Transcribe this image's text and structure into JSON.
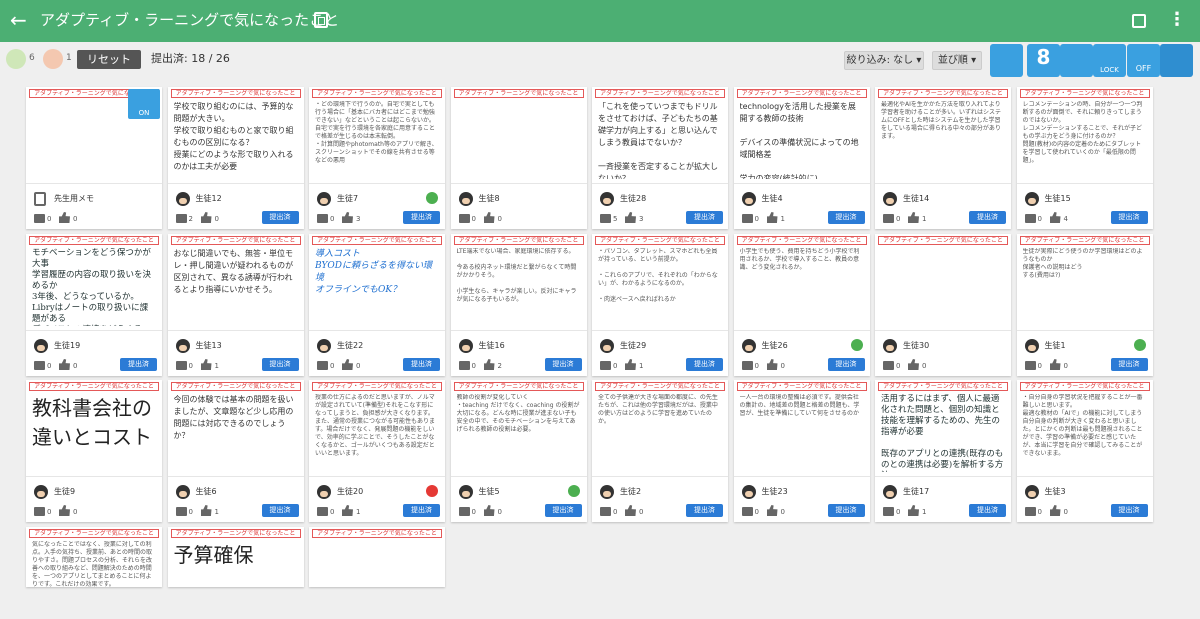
{
  "header": {
    "title": "アダプティブ・ラーニングで気になったこと",
    "back_icon": "arrow-left-icon",
    "copy_icon": "copy-icon",
    "translate_icon": "translate-icon",
    "more_icon": "more-vert-icon",
    "color": "#4caf73"
  },
  "toolbar": {
    "ok_label": "OK",
    "ok_count": "6",
    "ng_count": "1",
    "reset_label": "リセット",
    "submitted_text": "提出済: 18 / 26",
    "filter_label": "絞り込み: なし ▾",
    "sort_label": "並び順 ▾",
    "tools": {
      "font_size": "8",
      "lock_label": "LOCK",
      "off_label": "OFF"
    }
  },
  "card_tag": "アダプティブ・ラーニングで気になったこと",
  "submit_label": "提出済",
  "on_label": "ON",
  "cards": [
    {
      "name": "先生用メモ",
      "body": "",
      "comments": "0",
      "likes": "0"
    },
    {
      "name": "生徒12",
      "body": "学校で取り組むのには、予算的な問題が大きい。\n学校で取り組むものと家で取り組むものの区別になる？\n授業にどのような形で取り入れるのかは工夫が必要",
      "comments": "2",
      "likes": "0"
    },
    {
      "name": "生徒7",
      "body": "・どの環境下で行うのか。自宅で実としても行う場合に「基本にバカ者にはどこまで勉強できない」などということは起こらないか。\n自宅で実を行う環境を各家庭に用意することで格差が生じるのは本末転倒。\n・計算問題やphotomath等のアプリで解き、スクリーンショットでその線を共有させる等などの悪用",
      "comments": "0",
      "likes": "3"
    },
    {
      "name": "生徒8",
      "body": "",
      "comments": "0",
      "likes": "0"
    },
    {
      "name": "生徒28",
      "body": "「これを使っていつまでもドリルをさせておけば、子どもたちの基礎学力が向上する」と思い込んでしまう教員はでないか？\n\n一斉授業を否定することが拡大しないか？",
      "comments": "5",
      "likes": "3"
    },
    {
      "name": "生徒4",
      "body": "technologyを活用した授業を展開する教師の技術\n\nデバイスの準備状況によっての地域間格差\n\n学力の変容(統計的に)",
      "comments": "0",
      "likes": "1"
    },
    {
      "name": "生徒14",
      "body": "最適化やAIを生かかた方法を取り入れてより学習者を助けることが多い。いずれはシステムにOFFとした時はシステムを生かした学習をしている場合に得られる中々の部分があります。",
      "comments": "0",
      "likes": "1"
    },
    {
      "name": "生徒15",
      "body": "レコメンデーションの時、自分が一つ一つ判断するのが面倒で、それに頼りきってしまうのではないか。\nレコメンデーションすることで、それが子どもの学ぶ力をどう身に付けるのか？\n問題(教材)の内容の定着のためにタブレットを学習して使われていくのか「最低限の問題」。",
      "comments": "0",
      "likes": "4"
    },
    {
      "name": "生徒19",
      "body": "モチベーションをどう保つかが大事\n学習履歴の内容の取り扱いを決めるか\n3年後、どうなっているか。\nLibryはノートの取り扱いに課題がある\nデバイスとの連携をどうするか、費用負担をどうするか",
      "comments": "0",
      "likes": "0"
    },
    {
      "name": "生徒13",
      "body": "おなじ間違いでも、無答・単位モレ・押し間違いが疑われるものが区別されて、異なる誘導が行われるとより指導にいかせそう。",
      "comments": "0",
      "likes": "1"
    },
    {
      "name": "生徒22",
      "body": "導入コスト\nBYODに頼らざるを得ない環境\nオフラインでもOK？",
      "comments": "0",
      "likes": "0"
    },
    {
      "name": "生徒16",
      "body": "LTE端末でない場合、家庭環境に依存する。\n\n今ある校内ネット環境だと繋がらなくて時間がかかりそう。\n\n小学生なら、キャラが楽しい。反対にキャラが気になる子もいるが。",
      "comments": "0",
      "likes": "2"
    },
    {
      "name": "生徒29",
      "body": "・パソコン、タブレット、スマホどれも全員が持っている、という前提か。\n\n・これらのアプリで、それぞれの「わからない」が、わかるようになるのか。\n\n・肉迷ペースへ戻ればれるか",
      "comments": "0",
      "likes": "1"
    },
    {
      "name": "生徒26",
      "body": "小学生でも使う、費用を持ちどう小学校で利用されるか、学校で導入すること、教員の意識、どう変化されるか。",
      "comments": "0",
      "likes": "0"
    },
    {
      "name": "生徒30",
      "body": "",
      "comments": "0",
      "likes": "0"
    },
    {
      "name": "生徒1",
      "body": "生徒が実際にどう使うのか学習環境はどのようなものか\n保護者への説明はどう\nする(費用は?)",
      "comments": "0",
      "likes": "0"
    },
    {
      "name": "生徒9",
      "body": "教科書会社の違いとコスト",
      "comments": "0",
      "likes": "0"
    },
    {
      "name": "生徒6",
      "body": "今回の体験では基本の問題を扱いましたが、文章題など少し応用の問題には対応できるのでしょうか？",
      "comments": "0",
      "likes": "1"
    },
    {
      "name": "生徒20",
      "body": "授業の仕方によるのだと思いますが、ノルマが設定されていて(準備型)それをこなす形になってしまうと、負担感が大きくなります。また、通常の授業につながる可能性もあります。場合だけでなく、発展問題の機能をしいで、効率的に学ぶことで、そうしたことがなくなるかと、ゴールがいくつもある設定だといいと思います。",
      "comments": "0",
      "likes": "1"
    },
    {
      "name": "生徒5",
      "body": "教師の役割が変化していく\n・teaching だけでなく、coaching の役割が大切になる。どんな時に授業が進まない子も安全の中で、そのモチベーションを与えてあげられる教師の役割は必要。",
      "comments": "0",
      "likes": "0"
    },
    {
      "name": "生徒2",
      "body": "全ての子供達が大きな場面の都度に、の先生たちが、これは他の学習環境だがは、授業中の使い方はどのように学習を進めていたのか。",
      "comments": "0",
      "likes": "0"
    },
    {
      "name": "生徒23",
      "body": "一人一台の環境の整備は必須です。提供会社の集計の、地域差の問題と格差の問題も、学習が、生徒を準備にしていて何をさせるのか",
      "comments": "0",
      "likes": "0"
    },
    {
      "name": "生徒17",
      "body": "活用するにはまず、個人に最適化された問題と、個別の知識と技能を理解するための、先生の指導が必要\n\n既存のアプリとの連携(既存のものとの連携は必要)を解析する方法",
      "comments": "0",
      "likes": "1"
    },
    {
      "name": "生徒3",
      "body": "・自分自身の学習状況を把握することが一番難しいと思います。\n最適な教材の「AIで」の機能に対してしまう自分自身の判断が大きく変わると思いました。とにかくの判断は最も問題視されることができ、学習の準備が必要だと感じていたが、本当に学習を自分で確認してみることができないまま。",
      "comments": "0",
      "likes": "0"
    },
    {
      "name": "",
      "body": "気になったことではなく、授業に対しての利点。入手の気持ち、授業前、あとの時間の取りやすさ。問題プロセスの分析、それらを改善への取り組みなど、問題解決のための時間を、一つのアプリとしてまとめることに何よりです。これだけの効果です。",
      "comments": "",
      "likes": ""
    },
    {
      "name": "",
      "body": "予算確保",
      "comments": "",
      "likes": ""
    },
    {
      "name": "",
      "body": "",
      "comments": "",
      "likes": ""
    }
  ]
}
